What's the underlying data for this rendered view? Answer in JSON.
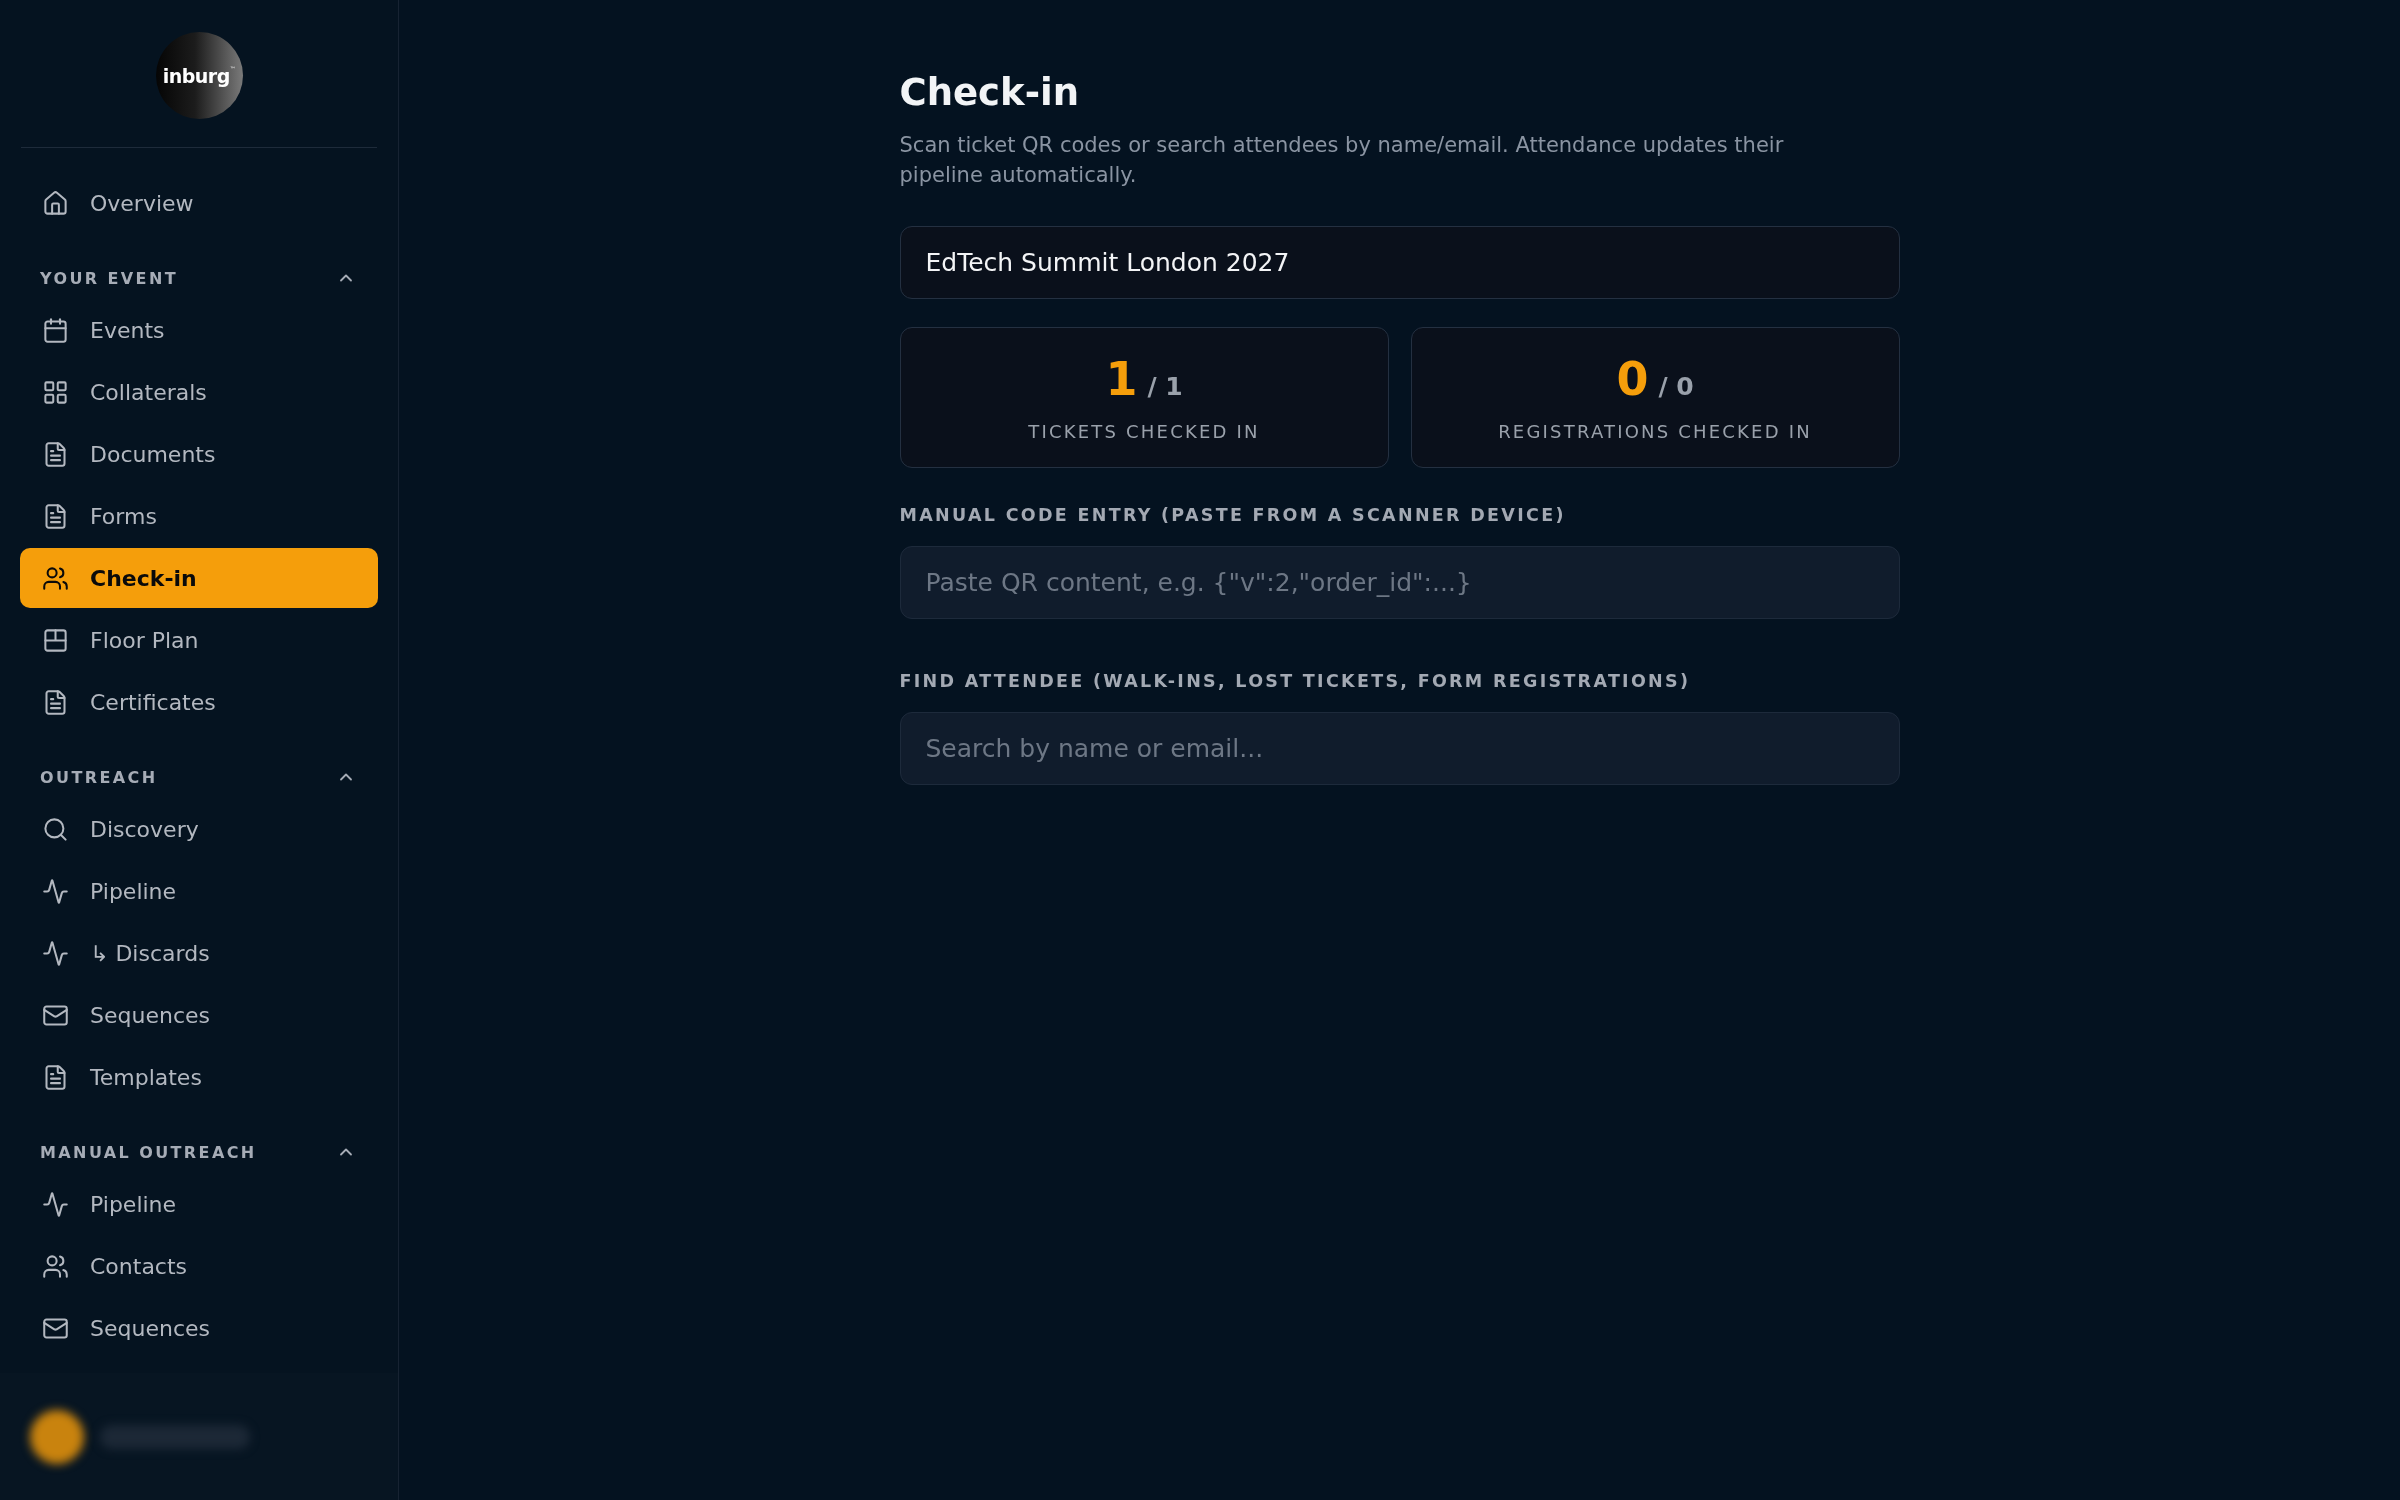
{
  "sidebar": {
    "logo": {
      "wordmark": "inburg$^{™}$"
    },
    "nav": [
      {
        "label": "Overview",
        "selected": false
      }
    ],
    "sections": [
      {
        "title": "YOUR EVENT",
        "expanded": true,
        "items": [
          {
            "label": "Events",
            "selected": false
          },
          {
            "label": "Collaterals",
            "selected": false
          },
          {
            "label": "Documents",
            "selected": false
          },
          {
            "label": "Forms",
            "selected": false
          },
          {
            "label": "Check-in",
            "selected": true
          },
          {
            "label": "Floor Plan",
            "selected": false
          },
          {
            "label": "Certificates",
            "selected": false
          }
        ]
      },
      {
        "title": "OUTREACH",
        "expanded": true,
        "items": [
          {
            "label": "Discovery",
            "selected": false
          },
          {
            "label": "Pipeline",
            "selected": false
          },
          {
            "label": "↳ Discards",
            "selected": false
          },
          {
            "label": "Sequences",
            "selected": false
          },
          {
            "label": "Templates",
            "selected": false
          }
        ]
      },
      {
        "title": "MANUAL OUTREACH",
        "expanded": true,
        "items": [
          {
            "label": "Pipeline",
            "selected": false
          },
          {
            "label": "Contacts",
            "selected": false
          },
          {
            "label": "Sequences",
            "selected": false
          }
        ]
      }
    ]
  },
  "page": {
    "title": "Check-in",
    "subtitle": "Scan ticket QR codes or search attendees by name/email. Attendance updates their pipeline automatically.",
    "event_select": {
      "value": "EdTech Summit London 2027"
    },
    "stats": [
      {
        "value": "1",
        "total": "/ 1",
        "label": "TICKETS CHECKED IN"
      },
      {
        "value": "0",
        "total": "/ 0",
        "label": "REGISTRATIONS CHECKED IN"
      }
    ],
    "fields": [
      {
        "label": "MANUAL CODE ENTRY (PASTE FROM A SCANNER DEVICE)",
        "placeholder": "Paste QR content, e.g. {\"v\":2,\"order_id\":...}"
      },
      {
        "label": "FIND ATTENDEE (WALK-INS, LOST TICKETS, FORM REGISTRATIONS)",
        "placeholder": "Search by name or email..."
      }
    ]
  }
}
